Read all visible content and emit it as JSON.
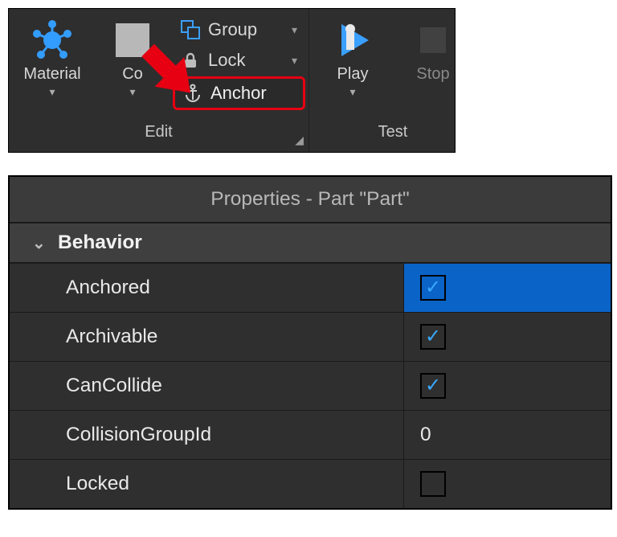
{
  "ribbon": {
    "material_label": "Material",
    "color_label": "Co",
    "group_label": "Group",
    "lock_label": "Lock",
    "anchor_label": "Anchor",
    "edit_section": "Edit",
    "play_label": "Play",
    "stop_label": "Stop",
    "test_section": "Test"
  },
  "properties": {
    "title": "Properties - Part \"Part\"",
    "category": "Behavior",
    "rows": {
      "anchored": {
        "label": "Anchored",
        "checked": true,
        "selected": true
      },
      "archivable": {
        "label": "Archivable",
        "checked": true
      },
      "cancollide": {
        "label": "CanCollide",
        "checked": true
      },
      "cgid": {
        "label": "CollisionGroupId",
        "value": "0"
      },
      "locked": {
        "label": "Locked",
        "checked": false
      }
    }
  }
}
